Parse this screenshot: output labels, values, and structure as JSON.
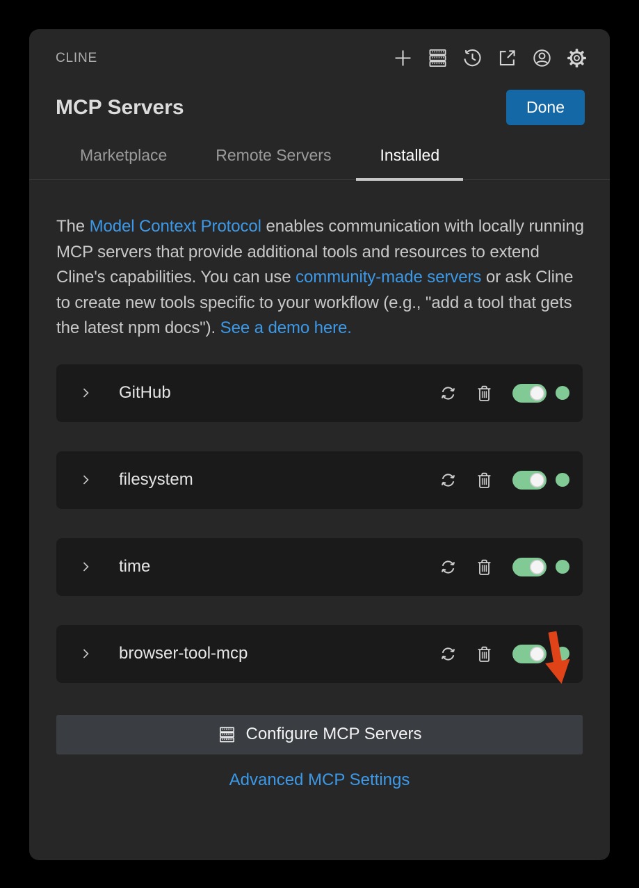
{
  "colors": {
    "accent_blue": "#1468a6",
    "link_blue": "#3c99e8",
    "toggle_green": "#81c995",
    "arrow_red": "#e04317"
  },
  "titlebar": {
    "app_label": "CLINE",
    "icons": [
      "new-task-plus",
      "mcp-servers",
      "history",
      "open-in-editor",
      "account",
      "settings-gear"
    ]
  },
  "page": {
    "title": "MCP Servers",
    "done_button": "Done"
  },
  "tabs": [
    {
      "label": "Marketplace",
      "active": false
    },
    {
      "label": "Remote Servers",
      "active": false
    },
    {
      "label": "Installed",
      "active": true
    }
  ],
  "description": {
    "segments": [
      {
        "type": "text",
        "text": "The "
      },
      {
        "type": "link",
        "text": "Model Context Protocol"
      },
      {
        "type": "text",
        "text": " enables communication with locally running MCP servers that provide additional tools and resources to extend Cline's capabilities. You can use "
      },
      {
        "type": "link",
        "text": "community-made servers"
      },
      {
        "type": "text",
        "text": " or ask Cline to create new tools specific to your workflow (e.g., \"add a tool that gets the latest npm docs\"). "
      },
      {
        "type": "link",
        "text": "See a demo here."
      }
    ]
  },
  "servers": [
    {
      "name": "GitHub",
      "enabled": true,
      "status": "connected"
    },
    {
      "name": "filesystem",
      "enabled": true,
      "status": "connected"
    },
    {
      "name": "time",
      "enabled": true,
      "status": "connected"
    },
    {
      "name": "browser-tool-mcp",
      "enabled": true,
      "status": "connected"
    }
  ],
  "footer": {
    "configure_button": "Configure MCP Servers",
    "advanced_link": "Advanced MCP Settings"
  },
  "annotation": {
    "type": "red-arrow",
    "points_at": "browser-tool-mcp-status-dot"
  }
}
